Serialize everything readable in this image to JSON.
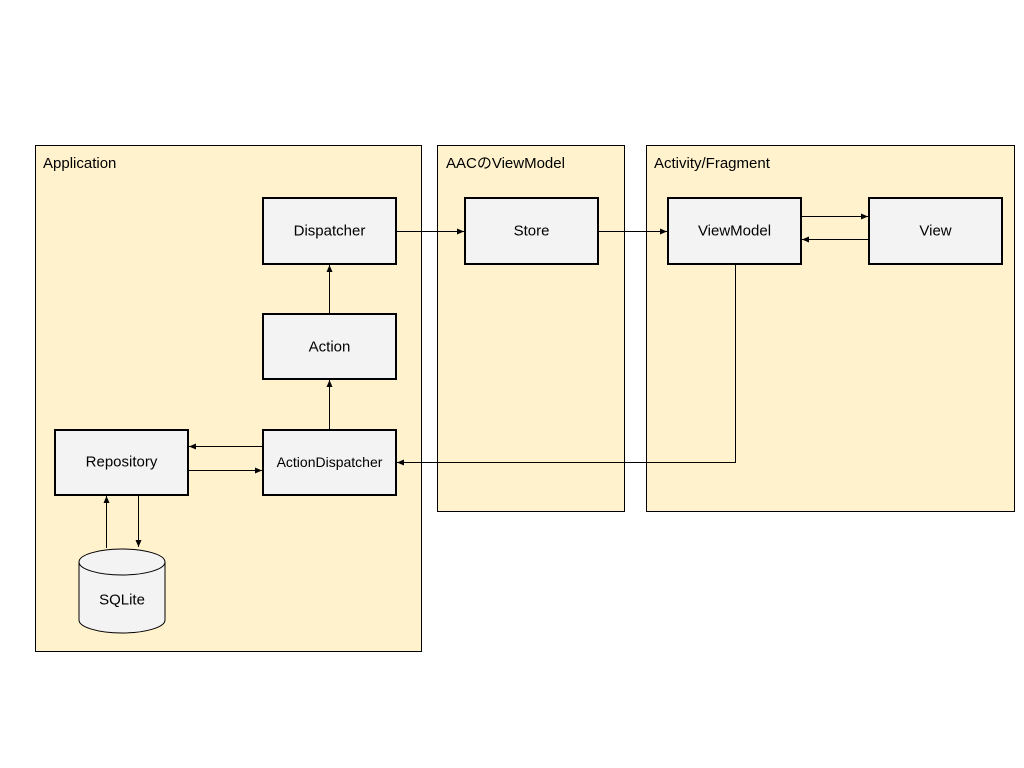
{
  "groups": {
    "application": "Application",
    "aac_viewmodel": "AACのViewModel",
    "activity_fragment": "Activity/Fragment"
  },
  "nodes": {
    "dispatcher": "Dispatcher",
    "action": "Action",
    "action_dispatcher": "ActionDispatcher",
    "repository": "Repository",
    "sqlite": "SQLite",
    "store": "Store",
    "viewmodel": "ViewModel",
    "view": "View"
  },
  "colors": {
    "group_fill": "#fff2cc",
    "node_fill": "#f3f3f3"
  }
}
